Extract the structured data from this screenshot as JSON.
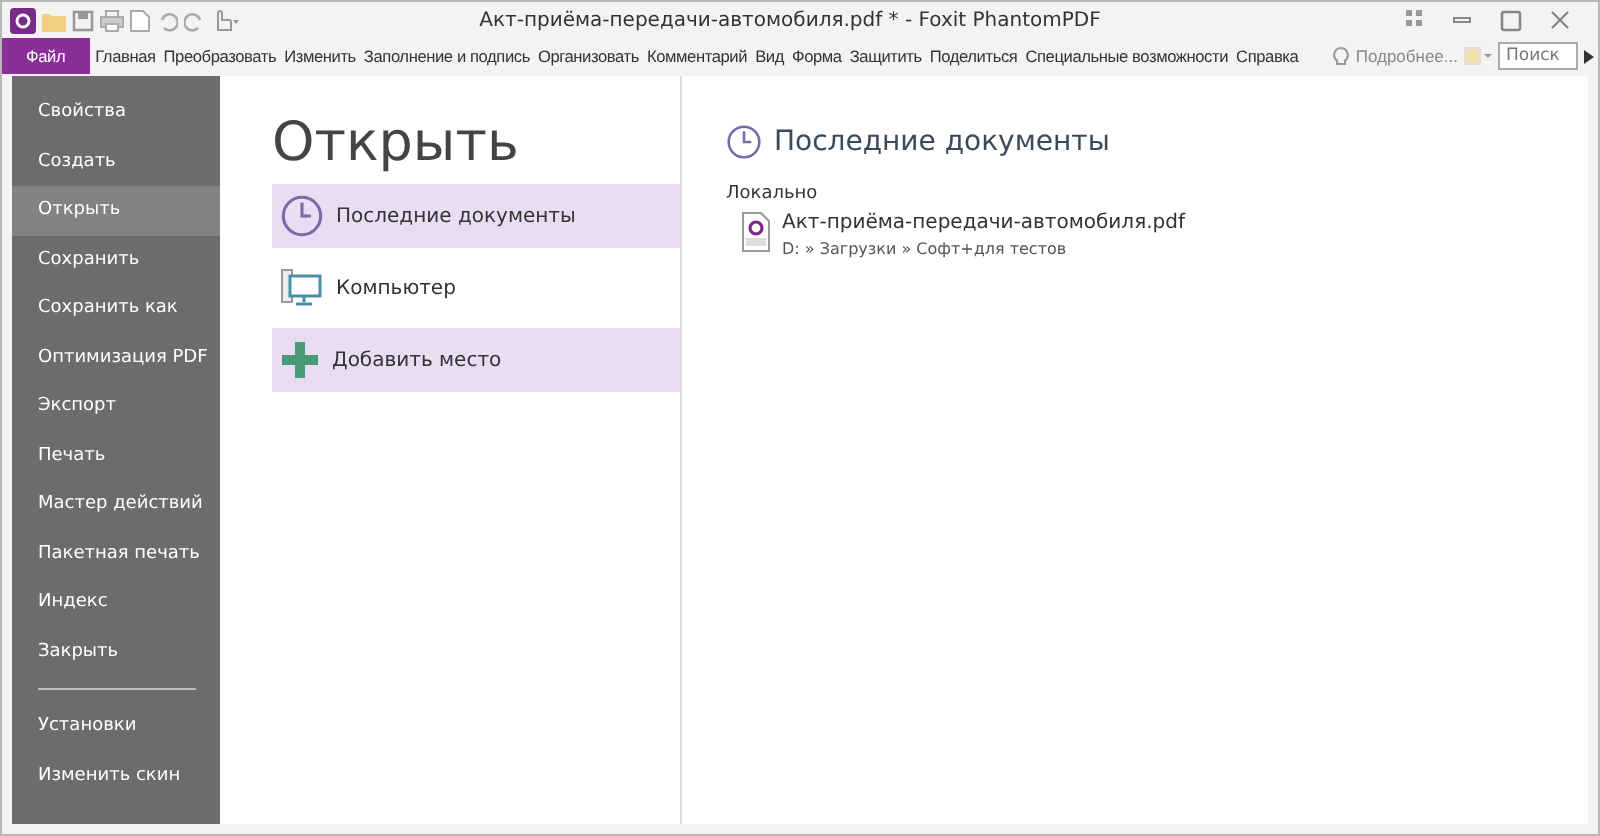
{
  "window": {
    "title": "Акт-приёма-передачи-автомобиля.pdf * - Foxit PhantomPDF"
  },
  "menu": [
    {
      "label": "Файл",
      "selected": true
    },
    {
      "label": "Главная",
      "selected": false
    },
    {
      "label": "Преобразовать",
      "selected": false
    },
    {
      "label": "Изменить",
      "selected": false
    },
    {
      "label": "Заполнение и подпись",
      "selected": false
    },
    {
      "label": "Организовать",
      "selected": false
    },
    {
      "label": "Комментарий",
      "selected": false
    },
    {
      "label": "Вид",
      "selected": false
    },
    {
      "label": "Форма",
      "selected": false
    },
    {
      "label": "Защитить",
      "selected": false
    },
    {
      "label": "Поделиться",
      "selected": false
    },
    {
      "label": "Специальные возможности",
      "selected": false
    },
    {
      "label": "Справка",
      "selected": false
    }
  ],
  "tell_me": "Подробнее...",
  "search": {
    "placeholder": "Поиск"
  },
  "sidebar": {
    "items": [
      {
        "label": "Свойства",
        "selected": false
      },
      {
        "label": "Создать",
        "selected": false
      },
      {
        "label": "Открыть",
        "selected": true
      },
      {
        "label": "Сохранить",
        "selected": false
      },
      {
        "label": "Сохранить как",
        "selected": false
      },
      {
        "label": "Оптимизация PDF",
        "selected": false
      },
      {
        "label": "Экспорт",
        "selected": false
      },
      {
        "label": "Печать",
        "selected": false
      },
      {
        "label": "Мастер действий",
        "selected": false
      },
      {
        "label": "Пакетная печать",
        "selected": false
      },
      {
        "label": "Индекс",
        "selected": false
      },
      {
        "label": "Закрыть",
        "selected": false
      }
    ],
    "footer_items": [
      {
        "label": "Установки",
        "selected": false
      },
      {
        "label": "Изменить скин",
        "selected": false
      }
    ]
  },
  "page_title": "Открыть",
  "places": [
    {
      "kind": "recent",
      "label": "Последние документы",
      "highlighted": true
    },
    {
      "kind": "computer",
      "label": "Компьютер",
      "highlighted": false
    },
    {
      "kind": "add",
      "label": "Добавить место",
      "highlighted": true
    }
  ],
  "recent": {
    "heading": "Последние документы",
    "group": "Локально",
    "files": [
      {
        "name": "Акт-приёма-передачи-автомобиля.pdf",
        "path": "D: » Загрузки » Софт+для тестов"
      }
    ]
  }
}
